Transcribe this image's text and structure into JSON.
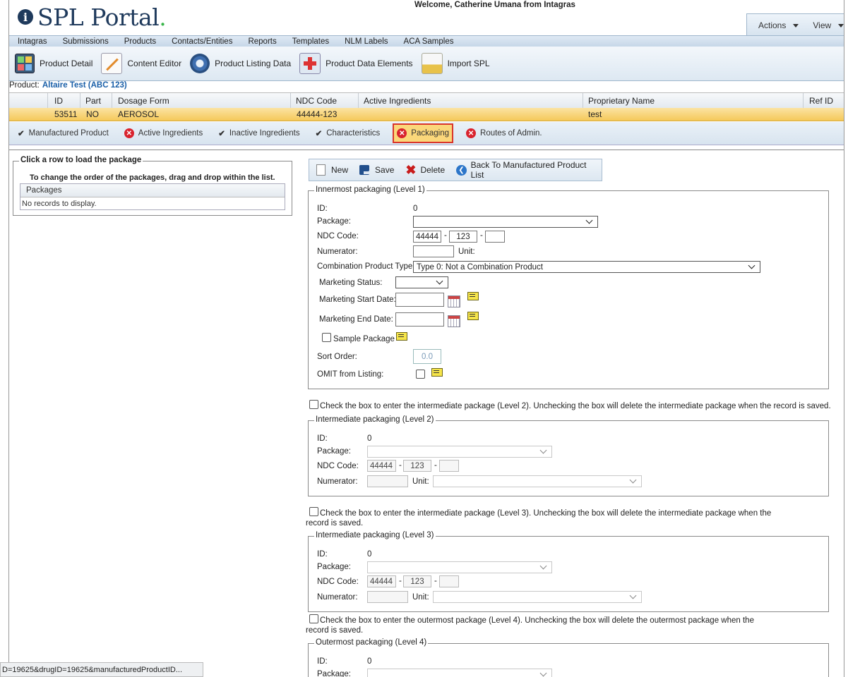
{
  "header": {
    "logo_text": "SPL Portal",
    "welcome": "Welcome, Catherine Umana from Intagras",
    "actions_label": "Actions",
    "view_label": "View"
  },
  "menu": [
    "Intagras",
    "Submissions",
    "Products",
    "Contacts/Entities",
    "Reports",
    "Templates",
    "NLM Labels",
    "ACA Samples"
  ],
  "toolbar": [
    {
      "label": "Product Detail",
      "icon": "product-detail-icon"
    },
    {
      "label": "Content Editor",
      "icon": "content-editor-icon"
    },
    {
      "label": "Product Listing Data",
      "icon": "gear-icon"
    },
    {
      "label": "Product Data Elements",
      "icon": "medical-kit-icon"
    },
    {
      "label": "Import SPL",
      "icon": "import-icon"
    }
  ],
  "product": {
    "label": "Product:",
    "name": "Altaire Test (ABC 123)"
  },
  "grid": {
    "columns": [
      "ID",
      "Part",
      "Dosage Form",
      "NDC Code",
      "Active Ingredients",
      "Proprietary Name",
      "Ref ID"
    ],
    "row": {
      "id": "53511",
      "part": "NO",
      "dosage_form": "AEROSOL",
      "ndc": "44444-123",
      "active": "",
      "proprietary": "test",
      "ref_id": ""
    }
  },
  "tabs": [
    {
      "label": "Manufactured Product",
      "status": "ok"
    },
    {
      "label": "Active Ingredients",
      "status": "error"
    },
    {
      "label": "Inactive Ingredients",
      "status": "ok"
    },
    {
      "label": "Characteristics",
      "status": "ok"
    },
    {
      "label": "Packaging",
      "status": "error",
      "active": true
    },
    {
      "label": "Routes of Admin.",
      "status": "error"
    }
  ],
  "left_panel": {
    "legend": "Click a row to load the package",
    "instruction": "To change the order of the packages, drag and drop within the list.",
    "column": "Packages",
    "empty": "No records to display."
  },
  "actions": {
    "new": "New",
    "save": "Save",
    "delete": "Delete",
    "back": "Back To Manufactured Product List"
  },
  "level1": {
    "legend": "Innermost packaging (Level 1)",
    "id_label": "ID:",
    "id_value": "0",
    "package_label": "Package:",
    "package_value": "",
    "ndc_label": "NDC Code:",
    "ndc1": "44444",
    "ndc2": "123",
    "ndc3": "",
    "numerator_label": "Numerator:",
    "unit_label": "Unit:",
    "combo_label": "Combination Product Type:",
    "combo_value": "Type 0: Not a Combination Product",
    "marketing_status_label": "Marketing Status:",
    "start_label": "Marketing Start Date:",
    "end_label": "Marketing End Date:",
    "sample_label": "Sample Package",
    "sort_label": "Sort Order:",
    "sort_value": "0.0",
    "omit_label": "OMIT from Listing:"
  },
  "level2": {
    "check_text": "Check the box to enter the intermediate package (Level 2). Unchecking the box will delete the intermediate package when the record is saved.",
    "legend": "Intermediate packaging (Level 2)",
    "id_label": "ID:",
    "id_value": "0",
    "package_label": "Package:",
    "ndc_label": "NDC Code:",
    "ndc1": "44444",
    "ndc2": "123",
    "numerator_label": "Numerator:",
    "unit_label": "Unit:"
  },
  "level3": {
    "check_text_1": "Check the box to enter the intermediate package (Level 3). Unchecking the box will delete the intermediate package when the",
    "check_text_2": "record is saved.",
    "legend": "Intermediate packaging (Level 3)",
    "id_label": "ID:",
    "id_value": "0",
    "package_label": "Package:",
    "ndc_label": "NDC Code:",
    "ndc1": "44444",
    "ndc2": "123",
    "numerator_label": "Numerator:",
    "unit_label": "Unit:"
  },
  "level4": {
    "check_text_1": "Check the box to enter the outermost package (Level 4). Unchecking the box will delete the outermost package when the",
    "check_text_2": "record is saved.",
    "legend": "Outermost packaging (Level 4)",
    "id_label": "ID:",
    "id_value": "0",
    "package_label": "Package:"
  },
  "status_url": "D=19625&drugID=19625&manufacturedProductID..."
}
